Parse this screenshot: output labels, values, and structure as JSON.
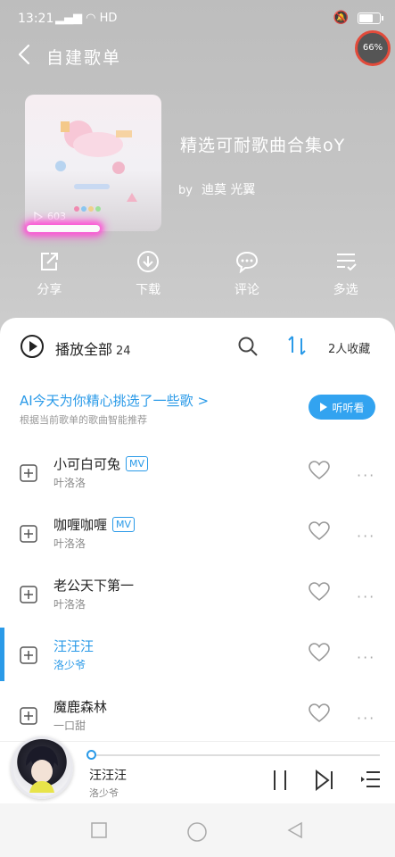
{
  "status_bar": {
    "time": "13:21",
    "network": "HD"
  },
  "battery_level": 0.62,
  "nav": {
    "title": "自建歌单",
    "progress_text": "66%"
  },
  "album": {
    "title": "精选可耐歌曲合集oY",
    "by_prefix": "by",
    "author": "迪莫 光翼",
    "play_count": "603"
  },
  "actions": [
    {
      "label": "分享",
      "icon": "share-icon"
    },
    {
      "label": "下载",
      "icon": "download-icon"
    },
    {
      "label": "评论",
      "icon": "comment-icon"
    },
    {
      "label": "多选",
      "icon": "multi-select-icon"
    }
  ],
  "list_header": {
    "play_all": "播放全部",
    "count": "24",
    "favorites": "2人收藏"
  },
  "ai_recommend": {
    "title": "AI今天为你精心挑选了一些歌 >",
    "subtitle": "根据当前歌单的歌曲智能推荐",
    "button": "听听看"
  },
  "songs": [
    {
      "name": "小可白可兔",
      "artist": "叶洛洛",
      "mv": "MV"
    },
    {
      "name": "咖喱咖喱",
      "artist": "叶洛洛",
      "mv": "MV"
    },
    {
      "name": "老公天下第一",
      "artist": "叶洛洛",
      "mv": ""
    },
    {
      "name": "汪汪汪",
      "artist": "洛少爷",
      "mv": ""
    },
    {
      "name": "魔鹿森林",
      "artist": "一口甜",
      "mv": ""
    }
  ],
  "now_playing": {
    "song": "汪汪汪",
    "artist": "洛少爷"
  },
  "colors": {
    "accent": "#2a9ae8",
    "glow": "#ff4fd6",
    "header_bg": "#c5c5c5"
  }
}
